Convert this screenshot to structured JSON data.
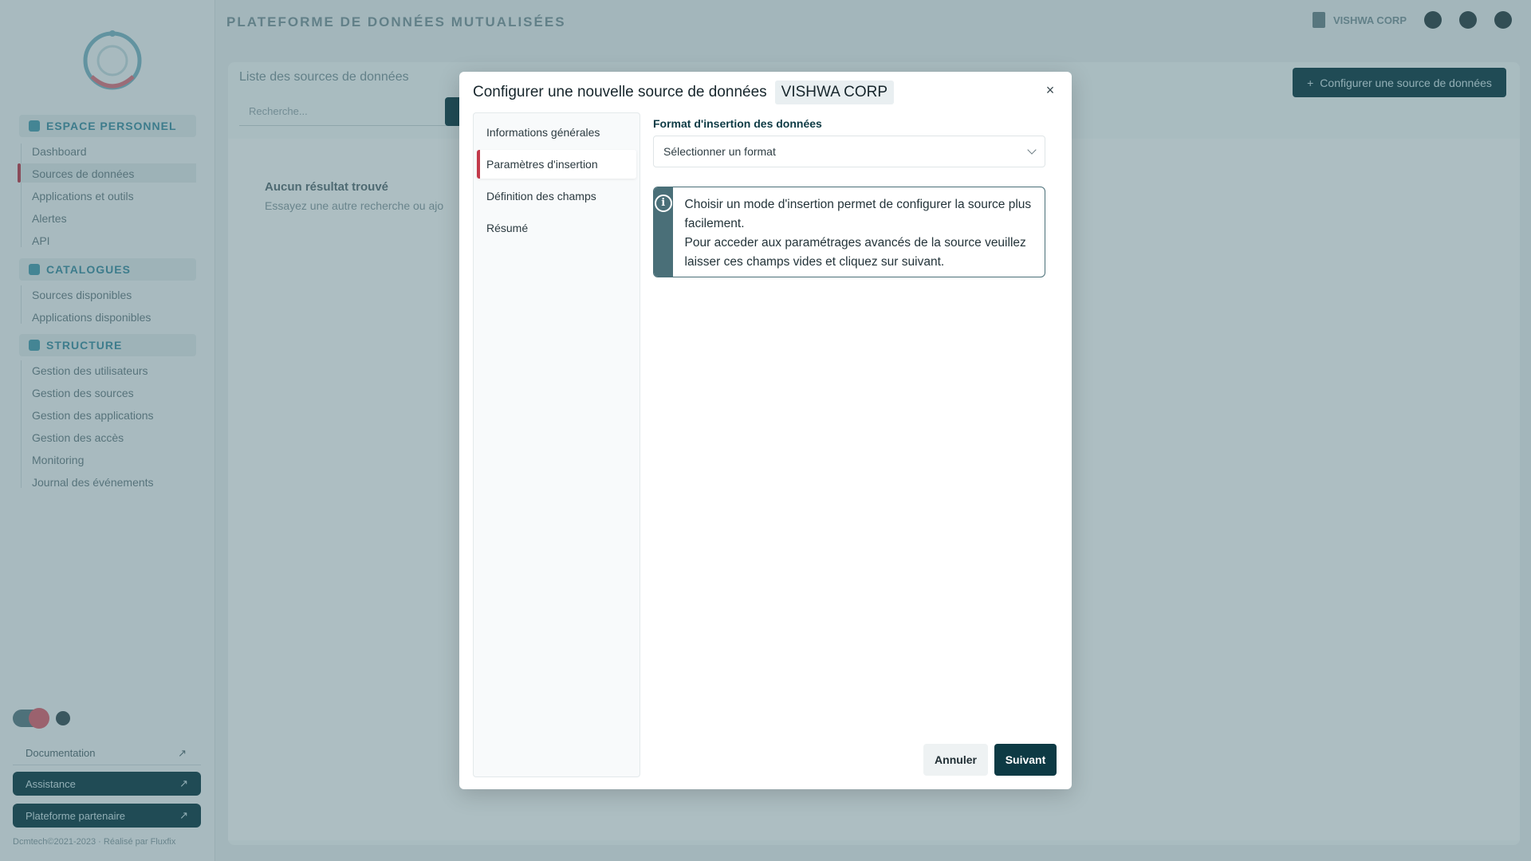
{
  "app": {
    "title": "PLATEFORME DE DONNÉES MUTUALISÉES",
    "org_name": "VISHWA CORP"
  },
  "sidebar": {
    "sections": [
      {
        "label": "ESPACE PERSONNEL",
        "items": [
          "Dashboard",
          "Sources de données",
          "Applications et outils",
          "Alertes",
          "API"
        ]
      },
      {
        "label": "CATALOGUES",
        "items": [
          "Sources disponibles",
          "Applications disponibles"
        ]
      },
      {
        "label": "STRUCTURE",
        "items": [
          "Gestion des utilisateurs",
          "Gestion des sources",
          "Gestion des applications",
          "Gestion des accès",
          "Monitoring",
          "Journal des événements"
        ]
      }
    ],
    "documentation": "Documentation",
    "btn_help": "Assistance",
    "btn_partners": "Plateforme partenaire",
    "footer": "Dcmtech©2021-2023 · Réalisé par Fluxfix"
  },
  "main": {
    "list_title": "Liste des sources de données",
    "search_placeholder": "Recherche...",
    "config_button": "Configurer une source de données",
    "no_result": "Aucun résultat trouvé",
    "no_result_sub": "Essayez une autre recherche ou ajo"
  },
  "modal": {
    "title": "Configurer une nouvelle source de données",
    "org_badge": "VISHWA CORP",
    "close": "×",
    "steps": [
      {
        "label": "Informations générales",
        "active": false
      },
      {
        "label": "Paramètres d'insertion",
        "active": true
      },
      {
        "label": "Définition des champs",
        "active": false
      },
      {
        "label": "Résumé",
        "active": false
      }
    ],
    "format_label": "Format d'insertion des données",
    "format_placeholder": "Sélectionner un format",
    "info_icon": "i",
    "info_line1": "Choisir un mode d'insertion permet de configurer la source plus facilement.",
    "info_line2": "Pour acceder aux paramétrages avancés de la source veuillez laisser ces champs vides et cliquez sur suivant.",
    "cancel": "Annuler",
    "next": "Suivant"
  },
  "colors": {
    "primary": "#0d3a44",
    "accent": "#c23a4a",
    "info": "#4a6f78"
  }
}
